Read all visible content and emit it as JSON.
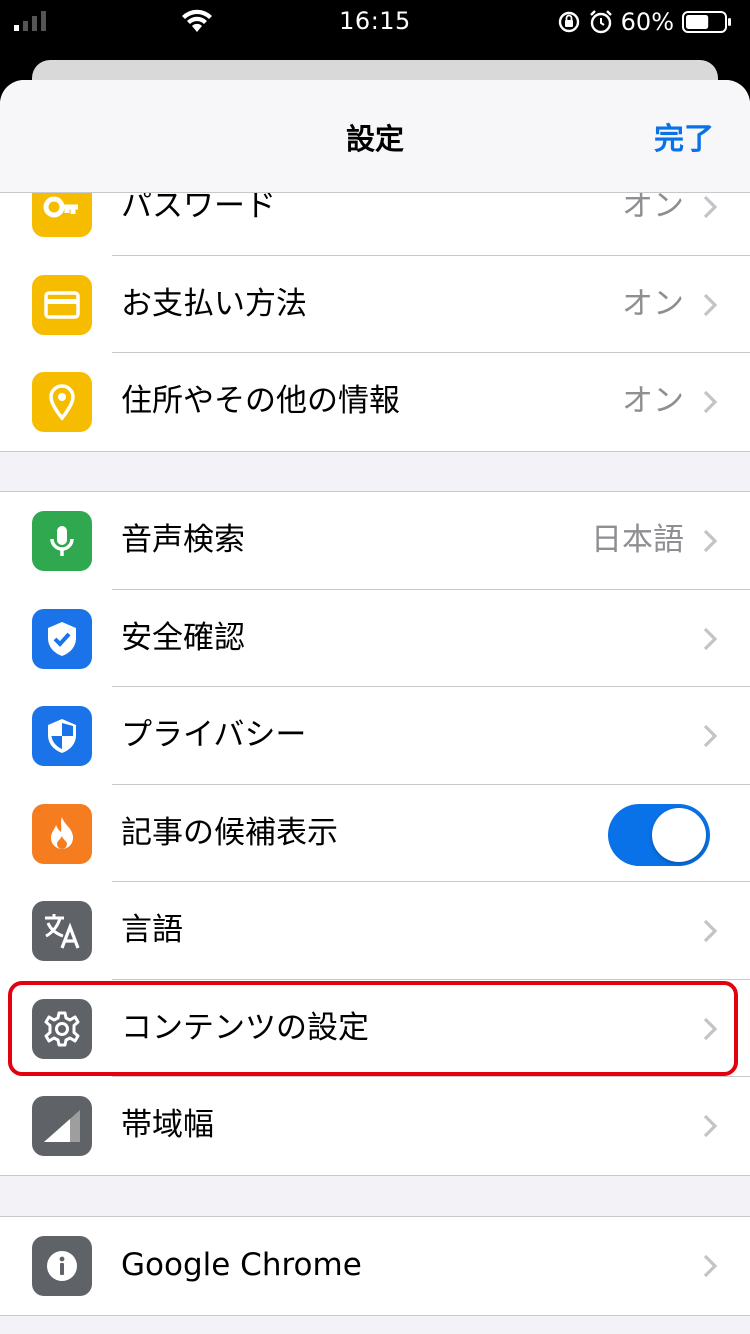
{
  "status_bar": {
    "time": "16:15",
    "battery_percent": "60%",
    "battery_level": 0.6,
    "icons": [
      "cellular-signal-icon",
      "wifi-icon",
      "orientation-lock-icon",
      "alarm-icon",
      "battery-icon"
    ]
  },
  "nav": {
    "title": "設定",
    "done_label": "完了"
  },
  "groups": [
    {
      "rows": [
        {
          "label": "パスワード",
          "value": "オン",
          "icon": "key-icon",
          "icon_bg": "#f6bd00"
        },
        {
          "label": "お支払い方法",
          "value": "オン",
          "icon": "credit-card-icon",
          "icon_bg": "#f6bd00"
        },
        {
          "label": "住所やその他の情報",
          "value": "オン",
          "icon": "location-pin-icon",
          "icon_bg": "#f6bd00"
        }
      ]
    },
    {
      "rows": [
        {
          "label": "音声検索",
          "value": "日本語",
          "icon": "microphone-icon",
          "icon_bg": "#2fa84f"
        },
        {
          "label": "安全確認",
          "value": "",
          "icon": "shield-check-icon",
          "icon_bg": "#1a73e8"
        },
        {
          "label": "プライバシー",
          "value": "",
          "icon": "privacy-shield-icon",
          "icon_bg": "#1a73e8"
        },
        {
          "label": "記事の候補表示",
          "value": "",
          "icon": "flame-icon",
          "icon_bg": "#f57c1f",
          "toggle_on": true
        },
        {
          "label": "言語",
          "value": "",
          "icon": "translate-icon",
          "icon_bg": "#5f6368"
        },
        {
          "label": "コンテンツの設定",
          "value": "",
          "icon": "gear-icon",
          "icon_bg": "#5f6368",
          "highlighted": true
        },
        {
          "label": "帯域幅",
          "value": "",
          "icon": "bandwidth-icon",
          "icon_bg": "#5f6368"
        }
      ]
    },
    {
      "rows": [
        {
          "label": "Google Chrome",
          "value": "",
          "icon": "info-icon",
          "icon_bg": "#5f6368"
        }
      ]
    }
  ],
  "colors": {
    "accent": "#0a72e8",
    "highlight_border": "#e3000f"
  }
}
